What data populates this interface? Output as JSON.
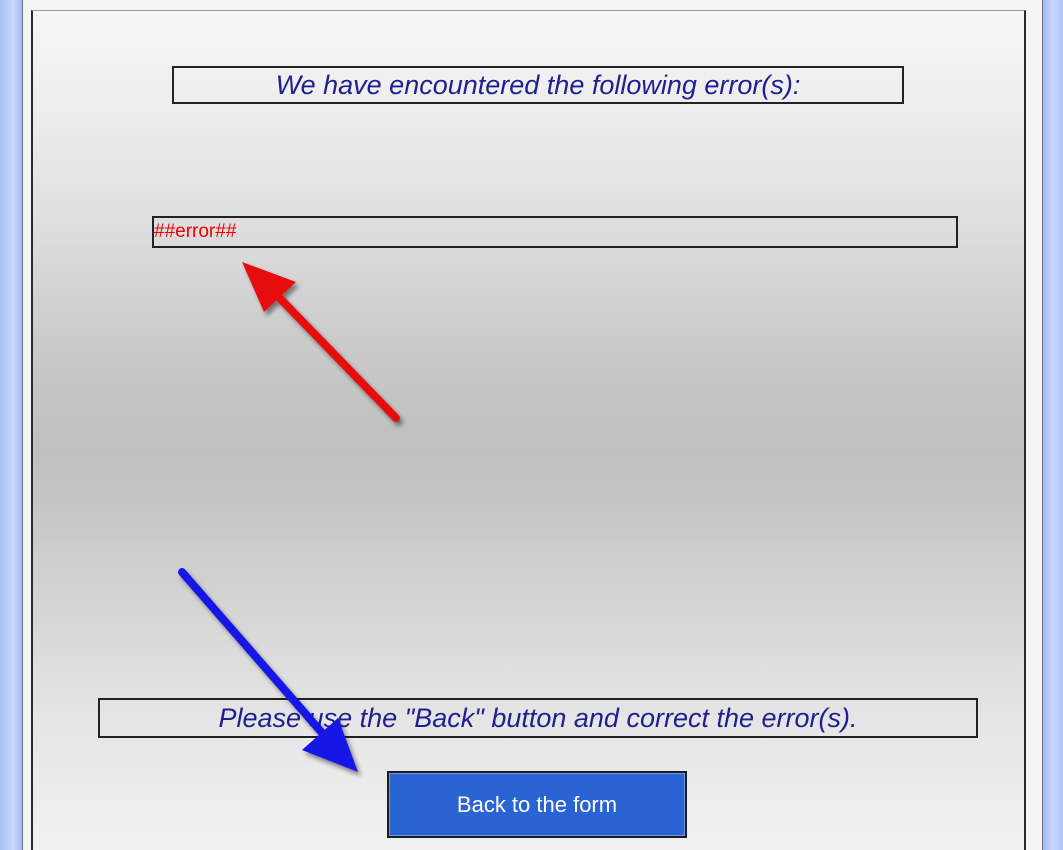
{
  "page": {
    "heading": "We have encountered the following error(s):",
    "error_placeholder": "##error##",
    "instructions": "Please use the \"Back\" button and correct the error(s).",
    "back_button_label": "Back to the form"
  },
  "annotations": {
    "red_arrow": {
      "color": "#e81010",
      "points_to": "error-placeholder"
    },
    "blue_arrow": {
      "color": "#1414e6",
      "points_to": "back-to-form-button"
    }
  },
  "colors": {
    "heading_text": "#1f1f8f",
    "error_text": "#f00000",
    "button_background": "#2a64d2",
    "button_text": "#ffffff"
  }
}
